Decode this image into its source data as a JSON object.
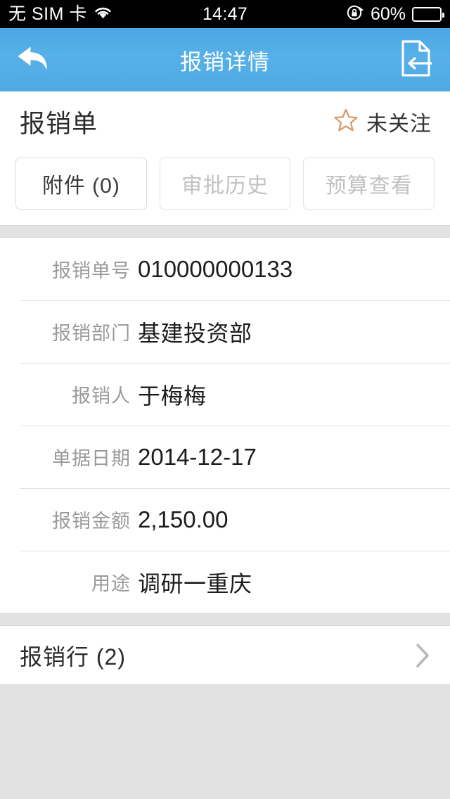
{
  "status_bar": {
    "carrier": "无 SIM 卡",
    "wifi_icon": "wifi-icon",
    "time": "14:47",
    "rotation_lock_icon": "rotation-lock-icon",
    "battery_percent": "60%",
    "battery_level": 60,
    "battery_icon": "battery-icon"
  },
  "nav_bar": {
    "back_icon": "back-arrow-icon",
    "title": "报销详情",
    "action_icon": "document-submit-icon",
    "background_color": "#54ade6"
  },
  "document": {
    "title": "报销单",
    "follow": {
      "star_icon": "star-outline-icon",
      "star_color": "#d99a5e",
      "label": "未关注"
    }
  },
  "tabs": [
    {
      "label": "附件 (0)",
      "name": "tab-attachments",
      "disabled": false
    },
    {
      "label": "审批历史",
      "name": "tab-approval-history",
      "disabled": true
    },
    {
      "label": "预算查看",
      "name": "tab-budget-view",
      "disabled": true
    }
  ],
  "fields": [
    {
      "label": "报销单号",
      "value": "010000000133",
      "numeric": true
    },
    {
      "label": "报销部门",
      "value": "基建投资部",
      "numeric": false
    },
    {
      "label": "报销人",
      "value": "于梅梅",
      "numeric": false
    },
    {
      "label": "单据日期",
      "value": "2014-12-17",
      "numeric": true
    },
    {
      "label": "报销金额",
      "value": "2,150.00",
      "numeric": true
    },
    {
      "label": "用途",
      "value": "调研一重庆",
      "numeric": false
    }
  ],
  "sections": [
    {
      "label": "报销行 (2)",
      "chevron_icon": "chevron-right-icon"
    }
  ]
}
